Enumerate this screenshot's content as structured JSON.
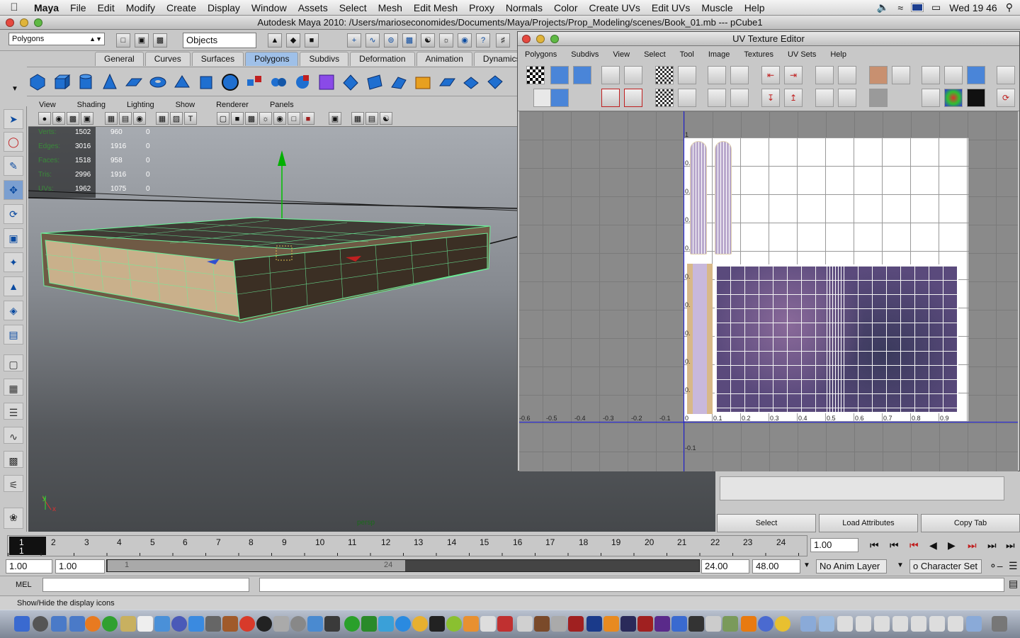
{
  "menubar": {
    "app": "Maya",
    "items": [
      "File",
      "Edit",
      "Modify",
      "Create",
      "Display",
      "Window",
      "Assets",
      "Select",
      "Mesh",
      "Edit Mesh",
      "Proxy",
      "Normals",
      "Color",
      "Create UVs",
      "Edit UVs",
      "Muscle",
      "Help"
    ],
    "clock": "Wed 19 46"
  },
  "window": {
    "title": "Autodesk Maya 2010: /Users/marioseconomides/Documents/Maya/Projects/Prop_Modeling/scenes/Book_01.mb  ---  pCube1"
  },
  "statusline": {
    "mode": "Polygons",
    "selection_field": "Objects"
  },
  "shelf_tabs": [
    "General",
    "Curves",
    "Surfaces",
    "Polygons",
    "Subdivs",
    "Deformation",
    "Animation",
    "Dynamics"
  ],
  "shelf_active": "Polygons",
  "panel_menu": [
    "View",
    "Shading",
    "Lighting",
    "Show",
    "Renderer",
    "Panels"
  ],
  "hud": {
    "rows": [
      {
        "label": "Verts:",
        "a": "1502",
        "b": "960",
        "c": "0"
      },
      {
        "label": "Edges:",
        "a": "3016",
        "b": "1916",
        "c": "0"
      },
      {
        "label": "Faces:",
        "a": "1518",
        "b": "958",
        "c": "0"
      },
      {
        "label": "Tris:",
        "a": "2996",
        "b": "1916",
        "c": "0"
      },
      {
        "label": "UVs:",
        "a": "1962",
        "b": "1075",
        "c": "0"
      }
    ]
  },
  "viewport": {
    "camera": "persp"
  },
  "uv_editor": {
    "title": "UV Texture Editor",
    "menu": [
      "Polygons",
      "Subdivs",
      "View",
      "Select",
      "Tool",
      "Image",
      "Textures",
      "UV Sets",
      "Help"
    ],
    "x_labels": [
      "-0.6",
      "-0.5",
      "-0.4",
      "-0.3",
      "-0.2",
      "-0.1",
      "0",
      "0.1",
      "0.2",
      "0.3",
      "0.4",
      "0.5",
      "0.6",
      "0.7",
      "0.8",
      "0.9"
    ],
    "y_labels": [
      "1",
      "0.",
      "0.",
      "0.",
      "0.",
      "0.",
      "0.",
      "0.",
      "0.",
      "0.",
      "-0.1"
    ]
  },
  "attr_buttons": [
    "Select",
    "Load Attributes",
    "Copy Tab"
  ],
  "timeline": {
    "ticks": [
      "1",
      "2",
      "3",
      "4",
      "5",
      "6",
      "7",
      "8",
      "9",
      "10",
      "11",
      "12",
      "13",
      "14",
      "15",
      "16",
      "17",
      "18",
      "19",
      "20",
      "21",
      "22",
      "23",
      "24"
    ],
    "current_frame": "1.00"
  },
  "range": {
    "start": "1.00",
    "inner_start": "1.00",
    "slider_left": "1",
    "slider_right": "24",
    "end": "24.00",
    "outer_end": "48.00",
    "anim_layer": "No Anim Layer",
    "char_set": "o Character Set"
  },
  "command": {
    "label": "MEL"
  },
  "help": {
    "text": "Show/Hide the display icons"
  }
}
